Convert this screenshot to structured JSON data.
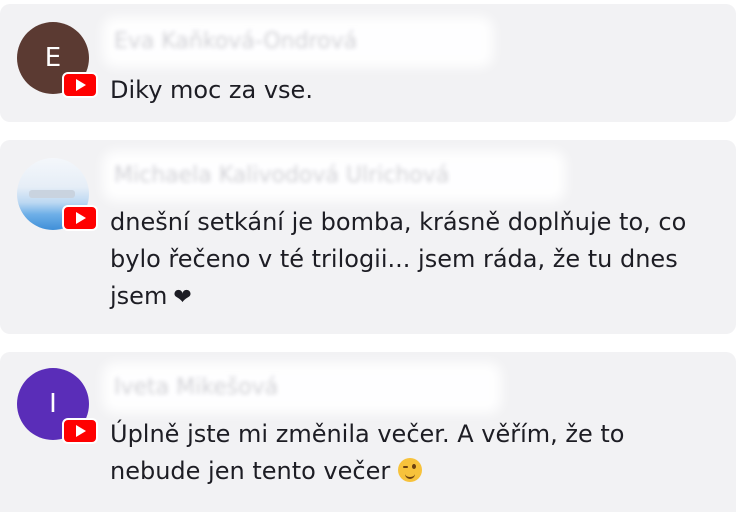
{
  "comments": [
    {
      "avatar_letter": "E",
      "avatar_color": "#5b3a32",
      "author": "Eva Kaňková-Ondrová",
      "platform_icon": "youtube-icon",
      "text": "Diky moc za vse."
    },
    {
      "avatar_letter": "",
      "avatar_color": "#6fb0e8",
      "author": "Michaela Kalivodová Ulrichová",
      "platform_icon": "youtube-icon",
      "text": "dnešní setkání je bomba, krásně doplňuje to, co bylo řečeno v té trilogii... jsem ráda, že tu dnes jsem",
      "emoji": "❤"
    },
    {
      "avatar_letter": "I",
      "avatar_color": "#5a2db8",
      "author": "Iveta Mikešová",
      "platform_icon": "youtube-icon",
      "text": "Úplně jste mi změnila večer. A věřím, že to nebude jen tento večer",
      "emoji": "winking-face"
    }
  ],
  "colors": {
    "card_background": "#f2f2f4",
    "text": "#1d1d24",
    "youtube_red": "#ff0000"
  }
}
